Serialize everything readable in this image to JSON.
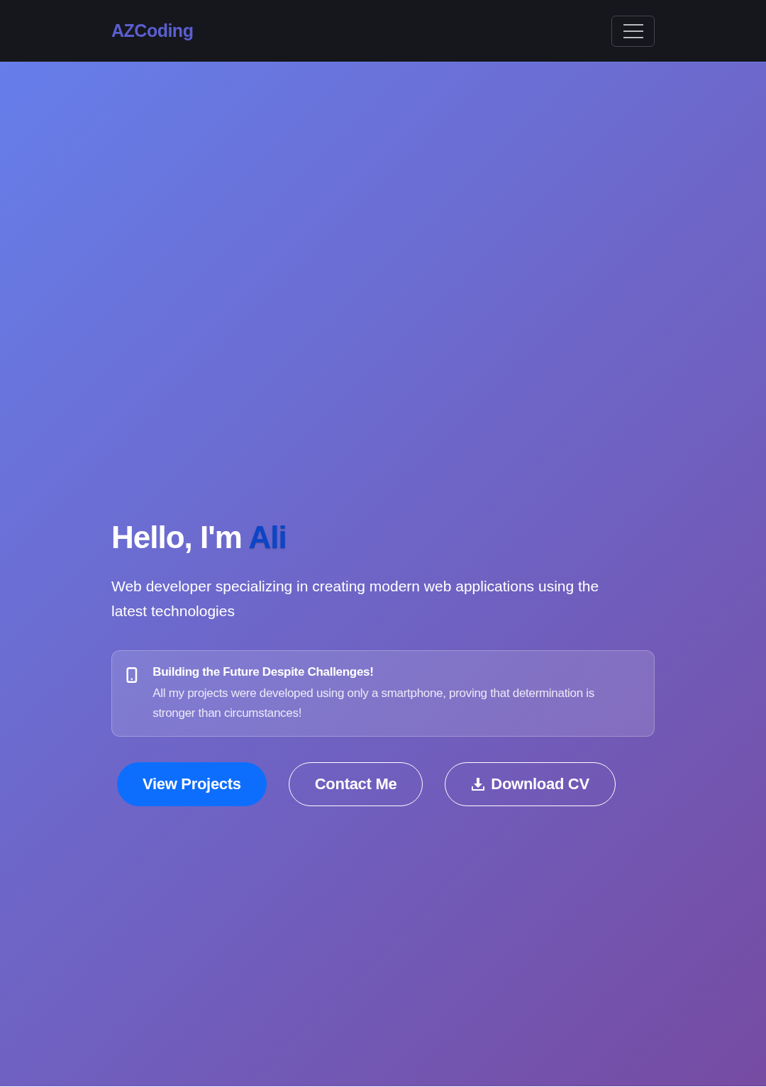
{
  "navbar": {
    "brand": "AZCoding"
  },
  "hero": {
    "greeting": "Hello, I'm ",
    "name": "Ali",
    "lead": "Web developer specializing in creating modern web applications using the latest technologies",
    "notice": {
      "title": "Building the Future Despite Challenges!",
      "text": "All my projects were developed using only a smartphone, proving that determination is stronger than circumstances!"
    },
    "buttons": [
      {
        "label": "View Projects",
        "kind": "primary"
      },
      {
        "label": "Contact Me",
        "kind": "outline"
      },
      {
        "label": "Download CV",
        "kind": "download"
      }
    ]
  }
}
